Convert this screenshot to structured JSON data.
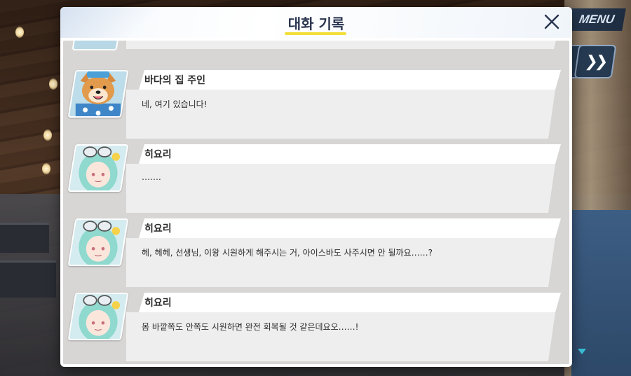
{
  "window": {
    "title": "대화 기록"
  },
  "hud": {
    "menu_label": "MENU",
    "fast_forward_icon": "double-chevron-right-icon"
  },
  "dialog": {
    "close_icon": "close-x-icon"
  },
  "entries": [
    {
      "speaker": "바다의 집 주인",
      "text": "네, 여기 있습니다!",
      "portrait": "shiba-dog-avatar"
    },
    {
      "speaker": "히요리",
      "text": "…….",
      "portrait": "hiyori-avatar"
    },
    {
      "speaker": "히요리",
      "text": "헤, 헤헤, 선생님, 이왕 시원하게 해주시는 거, 아이스바도 사주시면 안 될까요……?",
      "portrait": "hiyori-avatar"
    },
    {
      "speaker": "히요리",
      "text": "몸 바깥쪽도 안쪽도 시원하면 완전 회복될 것 같은데요오……!",
      "portrait": "hiyori-avatar"
    }
  ],
  "colors": {
    "accent_underline": "#f3df3c",
    "title": "#2a3550",
    "log_bg": "#d7d6d5",
    "scroll_indicator": "#3ac0d8"
  }
}
